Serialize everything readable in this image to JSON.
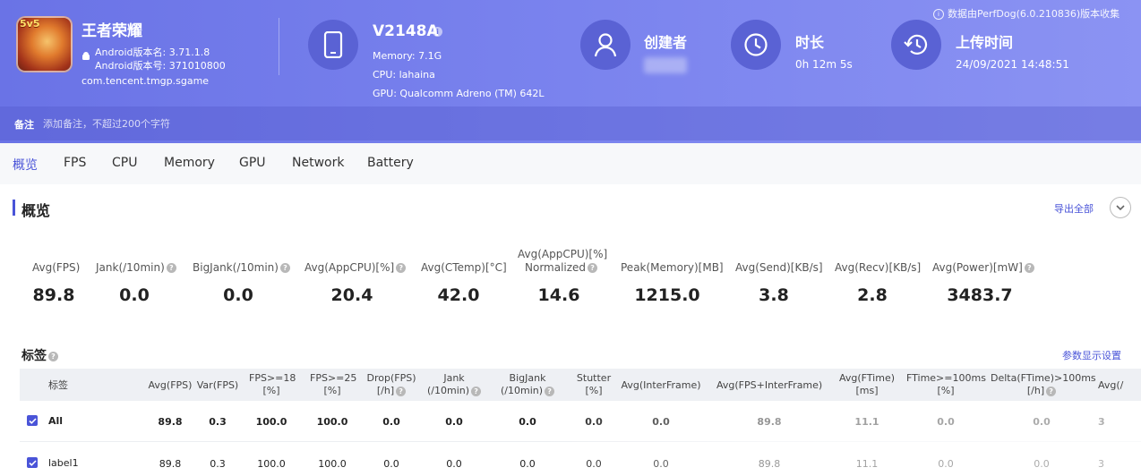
{
  "app": {
    "name": "王者荣耀",
    "badge": "5v5",
    "version_name": "Android版本名: 3.71.1.8",
    "version_code": "Android版本号: 371010800",
    "package": "com.tencent.tmgp.sgame"
  },
  "device": {
    "model": "V2148A",
    "memory": "Memory: 7.1G",
    "cpu": "CPU: lahaina",
    "gpu": "GPU: Qualcomm Adreno (TM) 642L"
  },
  "creator": {
    "label": "创建者"
  },
  "duration": {
    "label": "时长",
    "value": "0h 12m 5s"
  },
  "upload": {
    "label": "上传时间",
    "value": "24/09/2021 14:48:51"
  },
  "source_note": "数据由PerfDog(6.0.210836)版本收集",
  "note": {
    "label": "备注",
    "placeholder": "添加备注，不超过200个字符"
  },
  "tabs": [
    "概览",
    "FPS",
    "CPU",
    "Memory",
    "GPU",
    "Network",
    "Battery"
  ],
  "overview": {
    "title": "概览",
    "export_label": "导出全部",
    "stats": [
      {
        "label": "Avg(FPS)",
        "value": "89.8"
      },
      {
        "label": "Jank(/10min)",
        "value": "0.0"
      },
      {
        "label": "BigJank(/10min)",
        "value": "0.0"
      },
      {
        "label": "Avg(AppCPU)[%]",
        "value": "20.4"
      },
      {
        "label": "Avg(CTemp)[°C]",
        "value": "42.0"
      },
      {
        "label": "Avg(AppCPU)[%]",
        "label2": "Normalized",
        "value": "14.6"
      },
      {
        "label": "Peak(Memory)[MB]",
        "value": "1215.0"
      },
      {
        "label": "Avg(Send)[KB/s]",
        "value": "3.8"
      },
      {
        "label": "Avg(Recv)[KB/s]",
        "value": "2.8"
      },
      {
        "label": "Avg(Power)[mW]",
        "value": "3483.7"
      }
    ]
  },
  "tags": {
    "title": "标签",
    "param_link": "参数显示设置",
    "columns": [
      {
        "l1": "标签",
        "l2": ""
      },
      {
        "l1": "Avg(FPS)",
        "l2": ""
      },
      {
        "l1": "Var(FPS)",
        "l2": ""
      },
      {
        "l1": "FPS>=18",
        "l2": "[%]"
      },
      {
        "l1": "FPS>=25",
        "l2": "[%]"
      },
      {
        "l1": "Drop(FPS)",
        "l2": "[/h]"
      },
      {
        "l1": "Jank",
        "l2": "(/10min)"
      },
      {
        "l1": "BigJank",
        "l2": "(/10min)"
      },
      {
        "l1": "Stutter",
        "l2": "[%]"
      },
      {
        "l1": "Avg(InterFrame)",
        "l2": ""
      },
      {
        "l1": "Avg(FPS+InterFrame)",
        "l2": ""
      },
      {
        "l1": "Avg(FTime)",
        "l2": "[ms]"
      },
      {
        "l1": "FTime>=100ms",
        "l2": "[%]"
      },
      {
        "l1": "Delta(FTime)>100ms",
        "l2": "[/h]"
      },
      {
        "l1": "Avg(/",
        "l2": ""
      }
    ],
    "rows": [
      {
        "name": "All",
        "cells": [
          "89.8",
          "0.3",
          "100.0",
          "100.0",
          "0.0",
          "0.0",
          "0.0",
          "0.0",
          "0.0",
          "89.8",
          "11.1",
          "0.0",
          "0.0",
          "3"
        ]
      },
      {
        "name": "label1",
        "cells": [
          "89.8",
          "0.3",
          "100.0",
          "100.0",
          "0.0",
          "0.0",
          "0.0",
          "0.0",
          "0.0",
          "89.8",
          "11.1",
          "0.0",
          "0.0",
          "3"
        ]
      }
    ]
  },
  "colors": {
    "accent": "#4a54d8",
    "header_start": "#6a73e6",
    "header_end": "#8b93f3"
  }
}
